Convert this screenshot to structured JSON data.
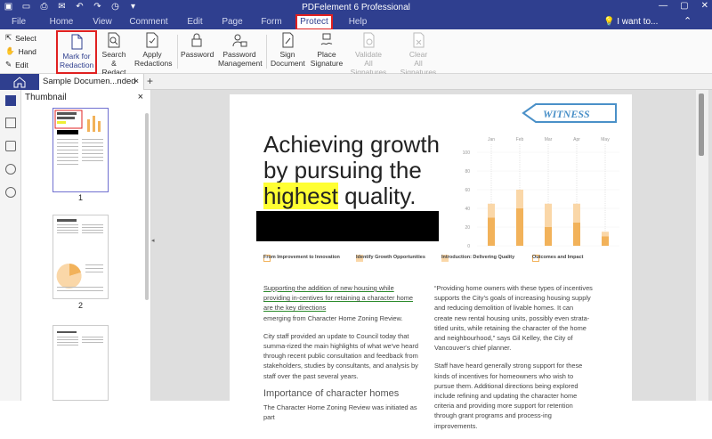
{
  "window": {
    "title": "PDFelement 6 Professional"
  },
  "menu": {
    "items": [
      "File",
      "Home",
      "View",
      "Comment",
      "Edit",
      "Page",
      "Form",
      "Protect",
      "Help"
    ],
    "active": "Protect",
    "want": "I want to..."
  },
  "ribbon": {
    "select": "Select",
    "hand": "Hand",
    "edit": "Edit",
    "mark_redaction": "Mark for\nRedaction",
    "search_redact": "Search &\nRedact",
    "apply_redactions": "Apply\nRedactions",
    "password": "Password",
    "password_mgmt": "Password\nManagement",
    "sign_document": "Sign\nDocument",
    "place_signature": "Place\nSignature",
    "validate_all": "Validate\nAll Signatures",
    "clear_all": "Clear\nAll Signatures"
  },
  "tabs": {
    "doc_tab": "Sample Documen...nded",
    "close": "×",
    "add": "+"
  },
  "thumbnail": {
    "title": "Thumbnail",
    "close": "×",
    "pages": [
      "1",
      "2"
    ]
  },
  "document": {
    "headline_1": "Achieving growth",
    "headline_2": "by pursuing the",
    "headline_hl": "highest",
    "headline_3": " quality.",
    "witness": "WITNESS",
    "labels": [
      "From Improvement to Innovation",
      "Identify Growth Opportunities",
      "Introduction: Delivering Quality",
      "Outcomes and Impact"
    ],
    "left_p1": "Supporting the addition of new housing while providing in-centives for retaining a character home are the key directions",
    "left_p1b": "emerging from Character Home Zoning Review.",
    "left_p2": "City staff provided an update to Council today that summa-rized the main highlights of what we've heard through recent public consultation and feedback from stakeholders, studies by consultants, and analysis by staff over the past several years.",
    "left_sub": "Importance of character homes",
    "left_p3": "The Character Home Zoning Review was initiated as part",
    "right_p1": "“Providing home owners with these types of incentives supports the City’s goals of increasing housing supply and reducing demolition of livable homes. It can create new rental housing units, possibly even strata-titled units, while retaining the character of the home and neighbourhood,” says Gil Kelley, the City of Vancouver’s chief planner.",
    "right_p2": "Staff have heard generally strong support for these kinds of incentives for homeowners who wish to pursue them. Additional directions being explored include refining and updating the character home criteria and providing more support for retention through grant programs and process-ing improvements."
  },
  "chart_data": {
    "type": "bar",
    "categories": [
      "Jan",
      "Feb",
      "Mar",
      "Apr",
      "May"
    ],
    "series": [
      {
        "values": [
          30,
          40,
          20,
          25,
          10
        ]
      },
      {
        "values": [
          15,
          20,
          25,
          20,
          5
        ]
      }
    ],
    "yticks": [
      "100",
      "80",
      "60",
      "40",
      "20",
      "0"
    ],
    "ylim": [
      0,
      100
    ],
    "colors": [
      "#f2b25a",
      "#fad7a8"
    ]
  }
}
